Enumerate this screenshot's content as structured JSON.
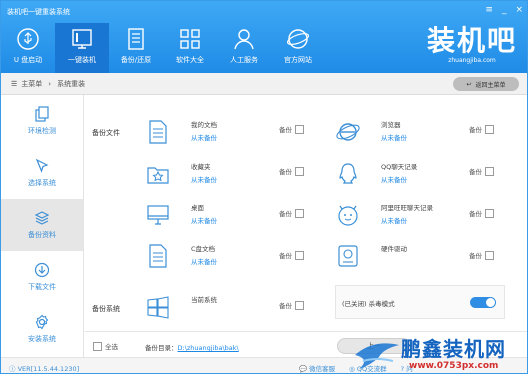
{
  "window": {
    "title": "装机吧一键重装系统",
    "controls": [
      "≡",
      "_",
      "×"
    ]
  },
  "nav": [
    {
      "label": "U 盘启动",
      "icon": "usb-icon"
    },
    {
      "label": "一键装机",
      "icon": "monitor-icon",
      "active": true
    },
    {
      "label": "备份/还原",
      "icon": "document-icon"
    },
    {
      "label": "软件大全",
      "icon": "grid-icon"
    },
    {
      "label": "人工服务",
      "icon": "person-icon"
    },
    {
      "label": "官方网站",
      "icon": "globe-icon"
    }
  ],
  "logo": {
    "text": "装机吧",
    "sub": "zhuangjiba.com"
  },
  "breadcrumb": {
    "home": "主菜单",
    "current": "系统重装",
    "back_label": "返回主菜单"
  },
  "sidebar": [
    {
      "label": "环境检测",
      "icon": "copy-icon"
    },
    {
      "label": "选择系统",
      "icon": "cursor-icon"
    },
    {
      "label": "备份资料",
      "icon": "layers-icon",
      "active": true
    },
    {
      "label": "下载文件",
      "icon": "download-icon"
    },
    {
      "label": "安装系统",
      "icon": "gear-icon"
    }
  ],
  "backup": {
    "files_label": "备份文件",
    "system_label": "备份系统",
    "backup_check_label": "备份",
    "not_backed_up": "从未备份",
    "items": [
      {
        "name": "我的文档",
        "status": "从未备份",
        "icon": "doc-icon"
      },
      {
        "name": "浏览器",
        "status": "从未备份",
        "icon": "ie-icon"
      },
      {
        "name": "收藏夹",
        "status": "从未备份",
        "icon": "star-folder-icon"
      },
      {
        "name": "QQ聊天记录",
        "status": "从未备份",
        "icon": "qq-icon"
      },
      {
        "name": "桌面",
        "status": "从未备份",
        "icon": "desktop-icon"
      },
      {
        "name": "阿里旺旺聊天记录",
        "status": "从未备份",
        "icon": "wangwang-icon"
      },
      {
        "name": "C盘文档",
        "status": "从未备份",
        "icon": "doc-icon"
      },
      {
        "name": "硬件驱动",
        "status": "",
        "icon": "disk-icon"
      }
    ],
    "system_item": {
      "name": "当前系统",
      "icon": "windows-icon"
    },
    "antivirus": "(已关闭) 杀毒模式"
  },
  "bottom": {
    "select_all": "全选",
    "path_label": "备份目录：",
    "path_value": "D:\\zhuangjiba\\bak\\",
    "next": "上一"
  },
  "footer": {
    "version": "VER[11.5.44.1230]",
    "links": [
      "微信客服",
      "QQ交流群",
      "问"
    ]
  },
  "watermark": {
    "title": "鹏鑫装机网",
    "url": "www.0753px.com"
  },
  "colors": {
    "header": "#2196f3",
    "accent": "#1e88e5",
    "toggle": "#2f8de4"
  }
}
